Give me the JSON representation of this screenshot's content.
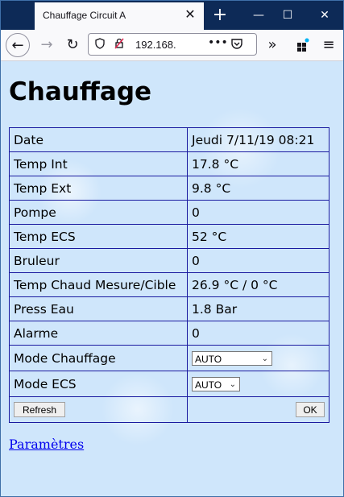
{
  "browser": {
    "tab_title": "Chauffage Circuit A",
    "url": "192.168.",
    "icons": {
      "tab_close": "close-icon",
      "new_tab": "plus-icon",
      "minimize": "minimize-icon",
      "maximize": "maximize-icon",
      "close": "close-icon",
      "back": "arrow-left-icon",
      "forward": "arrow-right-icon",
      "reload": "reload-icon",
      "shield": "shield-icon",
      "insecure": "insecure-lock-icon",
      "more": "ellipsis-icon",
      "pocket": "pocket-icon",
      "overflow": "chevron-double-right-icon",
      "extensions": "extensions-icon",
      "menu": "hamburger-menu-icon"
    }
  },
  "page": {
    "title": "Chauffage",
    "rows": [
      {
        "label": "Date",
        "value": "Jeudi 7/11/19 08:21"
      },
      {
        "label": "Temp Int",
        "value": "17.8 °C"
      },
      {
        "label": "Temp Ext",
        "value": "9.8 °C"
      },
      {
        "label": "Pompe",
        "value": "0"
      },
      {
        "label": "Temp ECS",
        "value": "52 °C"
      },
      {
        "label": "Bruleur",
        "value": "0"
      },
      {
        "label": "Temp Chaud Mesure/Cible",
        "value": "26.9 °C / 0 °C"
      },
      {
        "label": "Press Eau",
        "value": "1.8 Bar"
      },
      {
        "label": "Alarme",
        "value": "0"
      }
    ],
    "mode_chauffage": {
      "label": "Mode Chauffage",
      "value": "AUTO"
    },
    "mode_ecs": {
      "label": "Mode ECS",
      "value": "AUTO"
    },
    "refresh_label": "Refresh",
    "ok_label": "OK",
    "link_label": "Paramètres"
  },
  "colors": {
    "page_background": "#cfe6fb",
    "table_border": "#1a1aa0",
    "link": "#0000ee",
    "titlebar": "#0d2a57"
  }
}
